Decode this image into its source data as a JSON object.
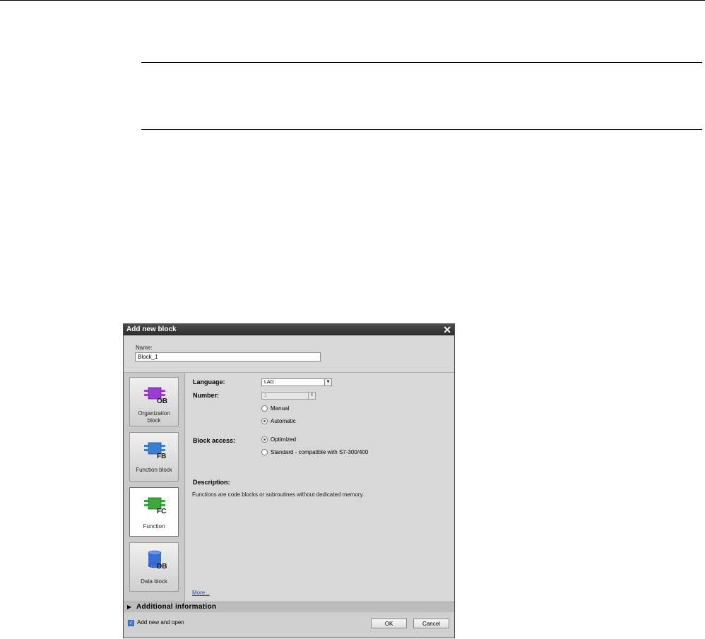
{
  "dialog": {
    "title": "Add new block",
    "close_glyph": "✕",
    "name": {
      "label": "Name:",
      "value": "Block_1"
    },
    "block_types": [
      {
        "code": "OB",
        "label_line1": "Organization",
        "label_line2": "block",
        "color": "#9b3bd4",
        "icon": "organization-block-icon"
      },
      {
        "code": "FB",
        "label_line1": "Function block",
        "label_line2": "",
        "color": "#3b7fd4",
        "icon": "function-block-icon"
      },
      {
        "code": "FC",
        "label_line1": "Function",
        "label_line2": "",
        "color": "#3ba83b",
        "icon": "function-icon",
        "selected": true
      },
      {
        "code": "DB",
        "label_line1": "Data block",
        "label_line2": "",
        "color": "#3b6ed4",
        "icon": "data-block-icon"
      }
    ],
    "language": {
      "label": "Language:",
      "value": "LAD"
    },
    "number": {
      "label": "Number:",
      "value": "1",
      "manual_label": "Manual",
      "automatic_label": "Automatic",
      "selected": "Automatic"
    },
    "block_access": {
      "label": "Block access:",
      "optimized_label": "Optimized",
      "standard_label": "Standard - compatible with S7-300/400",
      "selected": "Optimized"
    },
    "description": {
      "label": "Description:",
      "text": "Functions are code blocks or subroutines without dedicated memory."
    },
    "more_link": "More...",
    "additional_info_label": "Additional  information",
    "add_new_and_open": {
      "label": "Add new and open",
      "checked": true
    },
    "ok_label": "OK",
    "cancel_label": "Cancel"
  }
}
